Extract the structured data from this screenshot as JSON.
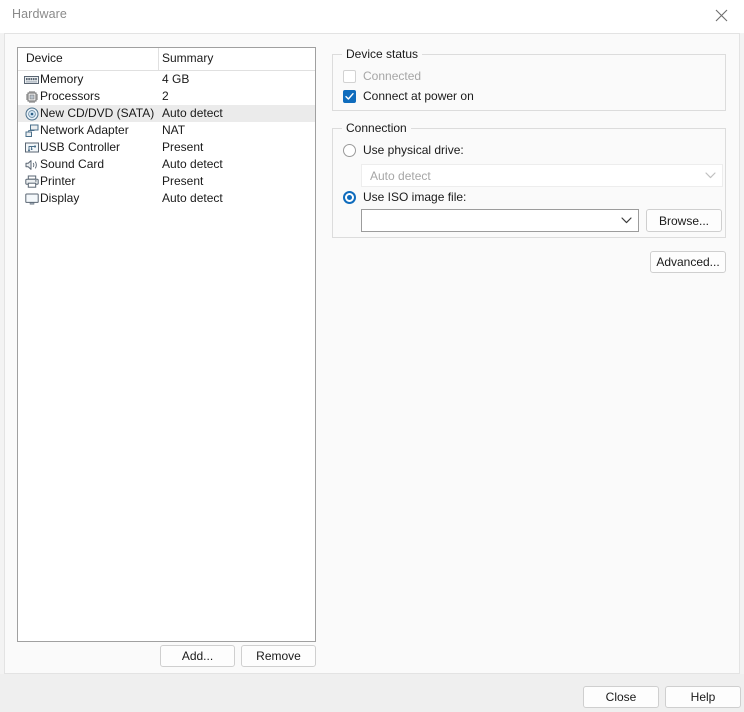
{
  "window": {
    "title": "Hardware",
    "close_icon": "close-icon"
  },
  "device_list": {
    "columns": {
      "device": "Device",
      "summary": "Summary"
    },
    "rows": [
      {
        "icon": "memory-icon",
        "name": "Memory",
        "summary": "4 GB",
        "selected": false
      },
      {
        "icon": "processor-icon",
        "name": "Processors",
        "summary": "2",
        "selected": false
      },
      {
        "icon": "cd-dvd-icon",
        "name": "New CD/DVD (SATA)",
        "summary": "Auto detect",
        "selected": true
      },
      {
        "icon": "network-adapter-icon",
        "name": "Network Adapter",
        "summary": "NAT",
        "selected": false
      },
      {
        "icon": "usb-controller-icon",
        "name": "USB Controller",
        "summary": "Present",
        "selected": false
      },
      {
        "icon": "sound-card-icon",
        "name": "Sound Card",
        "summary": "Auto detect",
        "selected": false
      },
      {
        "icon": "printer-icon",
        "name": "Printer",
        "summary": "Present",
        "selected": false
      },
      {
        "icon": "display-icon",
        "name": "Display",
        "summary": "Auto detect",
        "selected": false
      }
    ],
    "add_label": "Add...",
    "remove_label": "Remove"
  },
  "device_status": {
    "title": "Device status",
    "connected": {
      "label": "Connected",
      "checked": false,
      "enabled": false
    },
    "connect_at_power_on": {
      "label": "Connect at power on",
      "checked": true,
      "enabled": true
    }
  },
  "connection": {
    "title": "Connection",
    "use_physical_drive": {
      "label": "Use physical drive:",
      "selected": false
    },
    "physical_drive_value": "Auto detect",
    "use_iso_image": {
      "label": "Use ISO image file:",
      "selected": true
    },
    "iso_image_value": "",
    "iso_image_placeholder": "",
    "browse_label": "Browse...",
    "advanced_label": "Advanced..."
  },
  "footer": {
    "close_label": "Close",
    "help_label": "Help"
  },
  "colors": {
    "accent": "#0f6cbd",
    "selection_row": "#ebebeb",
    "panel_bg": "#fafafa",
    "footer_bg": "#efefef",
    "disabled_text": "#a6a6a6",
    "title_text": "#8a8a8a"
  }
}
